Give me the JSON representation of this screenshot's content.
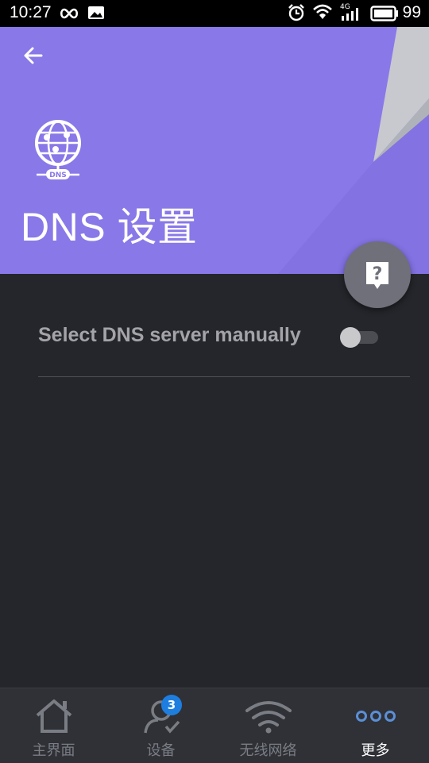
{
  "status_bar": {
    "time": "10:27",
    "network": "4G",
    "battery": "99"
  },
  "header": {
    "title": "DNS 设置",
    "icon_label": "DNS",
    "background_color": "#8878e8"
  },
  "setting": {
    "label": "Select DNS server manually",
    "toggle_on": false
  },
  "help_button": {
    "icon": "help-question-icon"
  },
  "bottom_nav": {
    "items": [
      {
        "label": "主界面",
        "icon": "home-icon"
      },
      {
        "label": "设备",
        "icon": "devices-icon",
        "badge": "3"
      },
      {
        "label": "无线网络",
        "icon": "wifi-icon"
      },
      {
        "label": "更多",
        "icon": "more-icon",
        "active": true
      }
    ],
    "active_color": "#ffffff",
    "badge_color": "#1e7ee0"
  }
}
